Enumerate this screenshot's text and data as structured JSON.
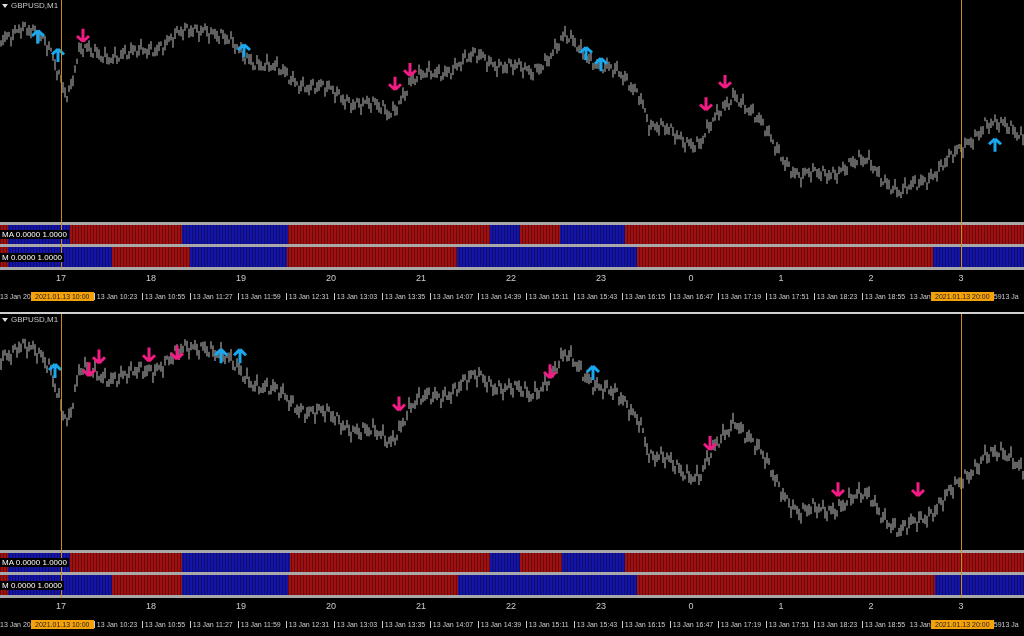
{
  "panels": [
    {
      "title": "GBPUSD,M1",
      "strips": [
        "MA 0.0000 1.0000",
        "M 0.0000 1.0000"
      ],
      "hours": [
        "17",
        "18",
        "19",
        "20",
        "21",
        "22",
        "23",
        "0",
        "1",
        "2",
        "3"
      ],
      "times": [
        {
          "kind": "partial",
          "text": "13 Jan 20"
        },
        {
          "kind": "cursor",
          "text": "2021.01.13 10:00"
        },
        {
          "kind": "tick",
          "text": "13 Jan 10:23"
        },
        {
          "kind": "tick",
          "text": "13 Jan 10:55"
        },
        {
          "kind": "tick",
          "text": "13 Jan 11:27"
        },
        {
          "kind": "tick",
          "text": "13 Jan 11:59"
        },
        {
          "kind": "tick",
          "text": "13 Jan 12:31"
        },
        {
          "kind": "tick",
          "text": "13 Jan 13:03"
        },
        {
          "kind": "tick",
          "text": "13 Jan 13:35"
        },
        {
          "kind": "tick",
          "text": "13 Jan 14:07"
        },
        {
          "kind": "tick",
          "text": "13 Jan 14:39"
        },
        {
          "kind": "tick",
          "text": "13 Jan 15:11"
        },
        {
          "kind": "tick",
          "text": "13 Jan 15:43"
        },
        {
          "kind": "tick",
          "text": "13 Jan 16:15"
        },
        {
          "kind": "tick",
          "text": "13 Jan 16:47"
        },
        {
          "kind": "tick",
          "text": "13 Jan 17:19"
        },
        {
          "kind": "tick",
          "text": "13 Jan 17:51"
        },
        {
          "kind": "tick",
          "text": "13 Jan 18:23"
        },
        {
          "kind": "tick",
          "text": "13 Jan 18:55"
        },
        {
          "kind": "partial",
          "text": "13 Jan"
        },
        {
          "kind": "cursor",
          "text": "2021.01.13 20:00"
        },
        {
          "kind": "partial",
          "text": "59"
        },
        {
          "kind": "partial",
          "text": "13 Ja"
        }
      ]
    },
    {
      "title": "GBPUSD,M1",
      "strips": [
        "MA 0.0000 1.0000",
        "M 0.0000 1.0000"
      ],
      "hours": [
        "17",
        "18",
        "19",
        "20",
        "21",
        "22",
        "23",
        "0",
        "1",
        "2",
        "3"
      ],
      "times": [
        {
          "kind": "partial",
          "text": "13 Jan 20"
        },
        {
          "kind": "cursor",
          "text": "2021.01.13 10:00"
        },
        {
          "kind": "tick",
          "text": "13 Jan 10:23"
        },
        {
          "kind": "tick",
          "text": "13 Jan 10:55"
        },
        {
          "kind": "tick",
          "text": "13 Jan 11:27"
        },
        {
          "kind": "tick",
          "text": "13 Jan 11:59"
        },
        {
          "kind": "tick",
          "text": "13 Jan 12:31"
        },
        {
          "kind": "tick",
          "text": "13 Jan 13:03"
        },
        {
          "kind": "tick",
          "text": "13 Jan 13:35"
        },
        {
          "kind": "tick",
          "text": "13 Jan 14:07"
        },
        {
          "kind": "tick",
          "text": "13 Jan 14:39"
        },
        {
          "kind": "tick",
          "text": "13 Jan 15:11"
        },
        {
          "kind": "tick",
          "text": "13 Jan 15:43"
        },
        {
          "kind": "tick",
          "text": "13 Jan 16:15"
        },
        {
          "kind": "tick",
          "text": "13 Jan 16:47"
        },
        {
          "kind": "tick",
          "text": "13 Jan 17:19"
        },
        {
          "kind": "tick",
          "text": "13 Jan 17:51"
        },
        {
          "kind": "tick",
          "text": "13 Jan 18:23"
        },
        {
          "kind": "tick",
          "text": "13 Jan 18:55"
        },
        {
          "kind": "partial",
          "text": "13 Jan"
        },
        {
          "kind": "cursor",
          "text": "2021.01.13 20:00"
        },
        {
          "kind": "partial",
          "text": "59"
        },
        {
          "kind": "partial",
          "text": "13 Ja"
        }
      ]
    }
  ]
}
